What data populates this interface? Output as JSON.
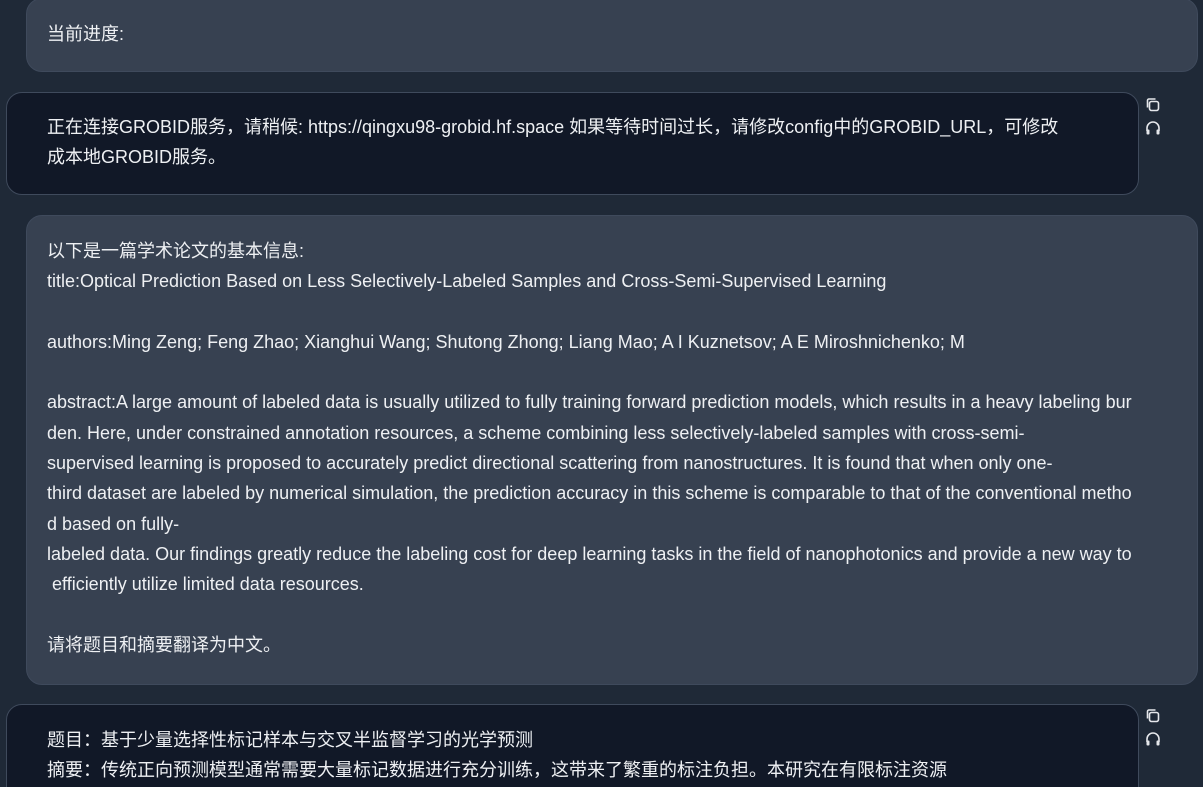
{
  "messages": [
    {
      "role": "user",
      "lines": [
        "当前进度:"
      ]
    },
    {
      "role": "assistant",
      "lines": [
        "正在连接GROBID服务，请稍候: https://qingxu98-grobid.hf.space 如果等待时间过长，请修改config中的GROBID_URL，可修改",
        "成本地GROBID服务。"
      ],
      "actions": [
        "copy-icon",
        "headphones-icon"
      ]
    },
    {
      "role": "user",
      "lines": [
        "以下是一篇学术论文的基本信息:",
        "title:Optical Prediction Based on Less Selectively-Labeled Samples and Cross-Semi-Supervised Learning",
        "",
        "authors:Ming Zeng; Feng Zhao; Xianghui Wang; Shutong Zhong; Liang Mao; A I Kuznetsov; A E Miroshnichenko; M",
        "",
        "abstract:A large amount of labeled data is usually utilized to fully training forward prediction models, which results in a heavy labeling bur",
        "den. Here, under constrained annotation resources, a scheme combining less selectively-labeled samples with cross-semi-",
        "supervised learning is proposed to accurately predict directional scattering from nanostructures. It is found that when only one-",
        "third dataset are labeled by numerical simulation, the prediction accuracy in this scheme is comparable to that of the conventional metho",
        "d based on fully-",
        "labeled data. Our findings greatly reduce the labeling cost for deep learning tasks in the field of nanophotonics and provide a new way to",
        " efficiently utilize limited data resources.",
        "",
        "请将题目和摘要翻译为中文。"
      ]
    },
    {
      "role": "assistant",
      "lines": [
        "题目：基于少量选择性标记样本与交叉半监督学习的光学预测",
        "摘要：传统正向预测模型通常需要大量标记数据进行充分训练，这带来了繁重的标注负担。本研究在有限标注资源"
      ],
      "actions": [
        "copy-icon",
        "headphones-icon"
      ]
    }
  ]
}
